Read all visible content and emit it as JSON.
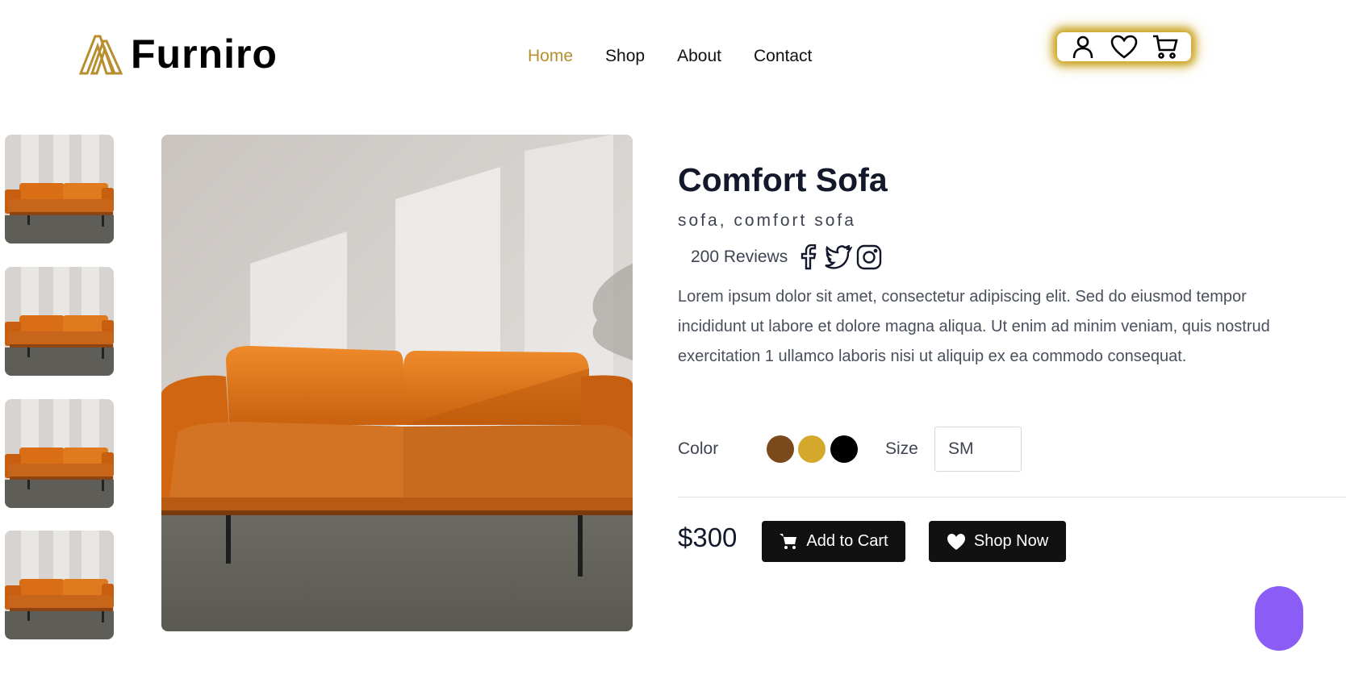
{
  "brand": {
    "name": "Furniro",
    "accent": "#b88e2f"
  },
  "nav": {
    "items": [
      {
        "label": "Home",
        "active": true
      },
      {
        "label": "Shop",
        "active": false
      },
      {
        "label": "About",
        "active": false
      },
      {
        "label": "Contact",
        "active": false
      }
    ]
  },
  "header_icons": [
    "user-icon",
    "heart-icon",
    "cart-icon"
  ],
  "gallery": {
    "thumbnail_count": 4
  },
  "product": {
    "title": "Comfort Sofa",
    "tags": "sofa, comfort sofa",
    "reviews": "200 Reviews",
    "social_icons": [
      "facebook-icon",
      "twitter-icon",
      "instagram-icon"
    ],
    "description": "Lorem ipsum dolor sit amet, consectetur adipiscing elit. Sed do eiusmod tempor incididunt ut labore et dolore magna aliqua. Ut enim ad minim veniam, quis nostrud exercitation 1 ullamco laboris nisi ut aliquip ex ea commodo consequat.",
    "color_label": "Color",
    "colors": [
      "#7a4a1c",
      "#d4a82a",
      "#000000"
    ],
    "size_label": "Size",
    "size_value": "SM",
    "price": "$300",
    "add_to_cart_label": "Add to Cart",
    "shop_now_label": "Shop Now"
  }
}
